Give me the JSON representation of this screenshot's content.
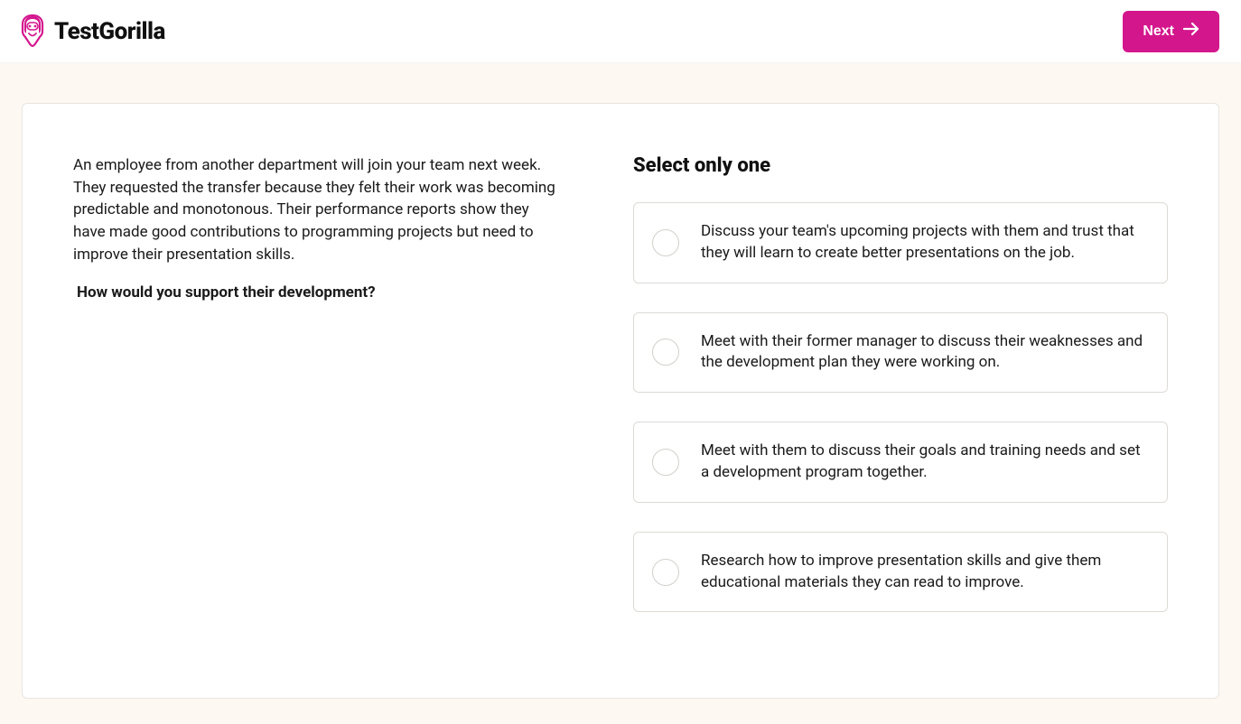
{
  "header": {
    "brand": "TestGorilla",
    "next_label": "Next"
  },
  "question": {
    "scenario": "An employee from another department will join your team next week. They requested the transfer because they felt their work was becoming predictable and monotonous. Their performance reports show they have made good contributions to programming projects but need to improve their presentation skills.",
    "prompt": "How would you support their development?",
    "select_heading": "Select only one",
    "options": [
      "Discuss your team's upcoming projects with them and trust that they will learn to create better presentations on the job.",
      "Meet with their former manager to discuss their weaknesses and the development plan they were working on.",
      "Meet with them to discuss their goals and training needs and set a development program together.",
      "Research how to improve presentation skills and give them educational materials they can read to improve."
    ]
  }
}
